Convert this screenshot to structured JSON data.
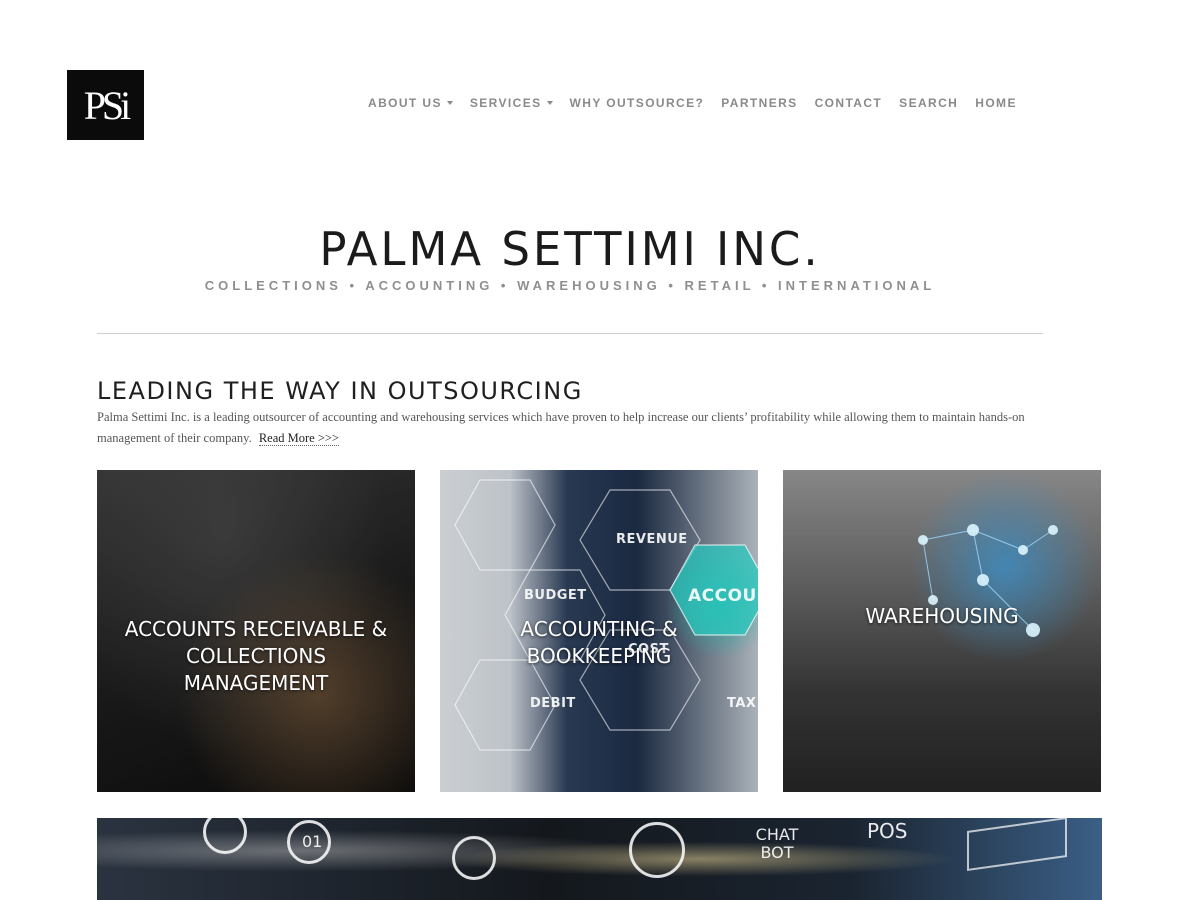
{
  "logo": {
    "text": "PSi"
  },
  "nav": {
    "items": [
      {
        "label": "ABOUT US",
        "dropdown": true
      },
      {
        "label": "SERVICES",
        "dropdown": true
      },
      {
        "label": "WHY OUTSOURCE?",
        "dropdown": false
      },
      {
        "label": "PARTNERS",
        "dropdown": false
      },
      {
        "label": "CONTACT",
        "dropdown": false
      },
      {
        "label": "SEARCH",
        "dropdown": false
      },
      {
        "label": "HOME",
        "dropdown": false
      }
    ]
  },
  "header": {
    "title": "PALMA SETTIMI INC.",
    "tagline": "COLLECTIONS • ACCOUNTING • WAREHOUSING • RETAIL • INTERNATIONAL"
  },
  "intro": {
    "heading": "LEADING THE WAY IN OUTSOURCING",
    "text": "Palma Settimi Inc. is a leading outsourcer of accounting and warehousing services which have proven to help increase our clients’ profitability while allowing them to maintain hands-on management of their company.",
    "read_more": "Read More >>>"
  },
  "cards": [
    {
      "title": "ACCOUNTS RECEIVABLE & COLLECTIONS MANAGEMENT"
    },
    {
      "title": "ACCOUNTING & BOOKKEEPING",
      "image_words": [
        "REVENUE",
        "BUDGET",
        "ACCOUNT",
        "COST",
        "DEBIT",
        "TAX"
      ]
    },
    {
      "title": "WAREHOUSING"
    }
  ],
  "banner": {
    "image_words": [
      "CHAT BOT",
      "POS",
      "01"
    ]
  }
}
